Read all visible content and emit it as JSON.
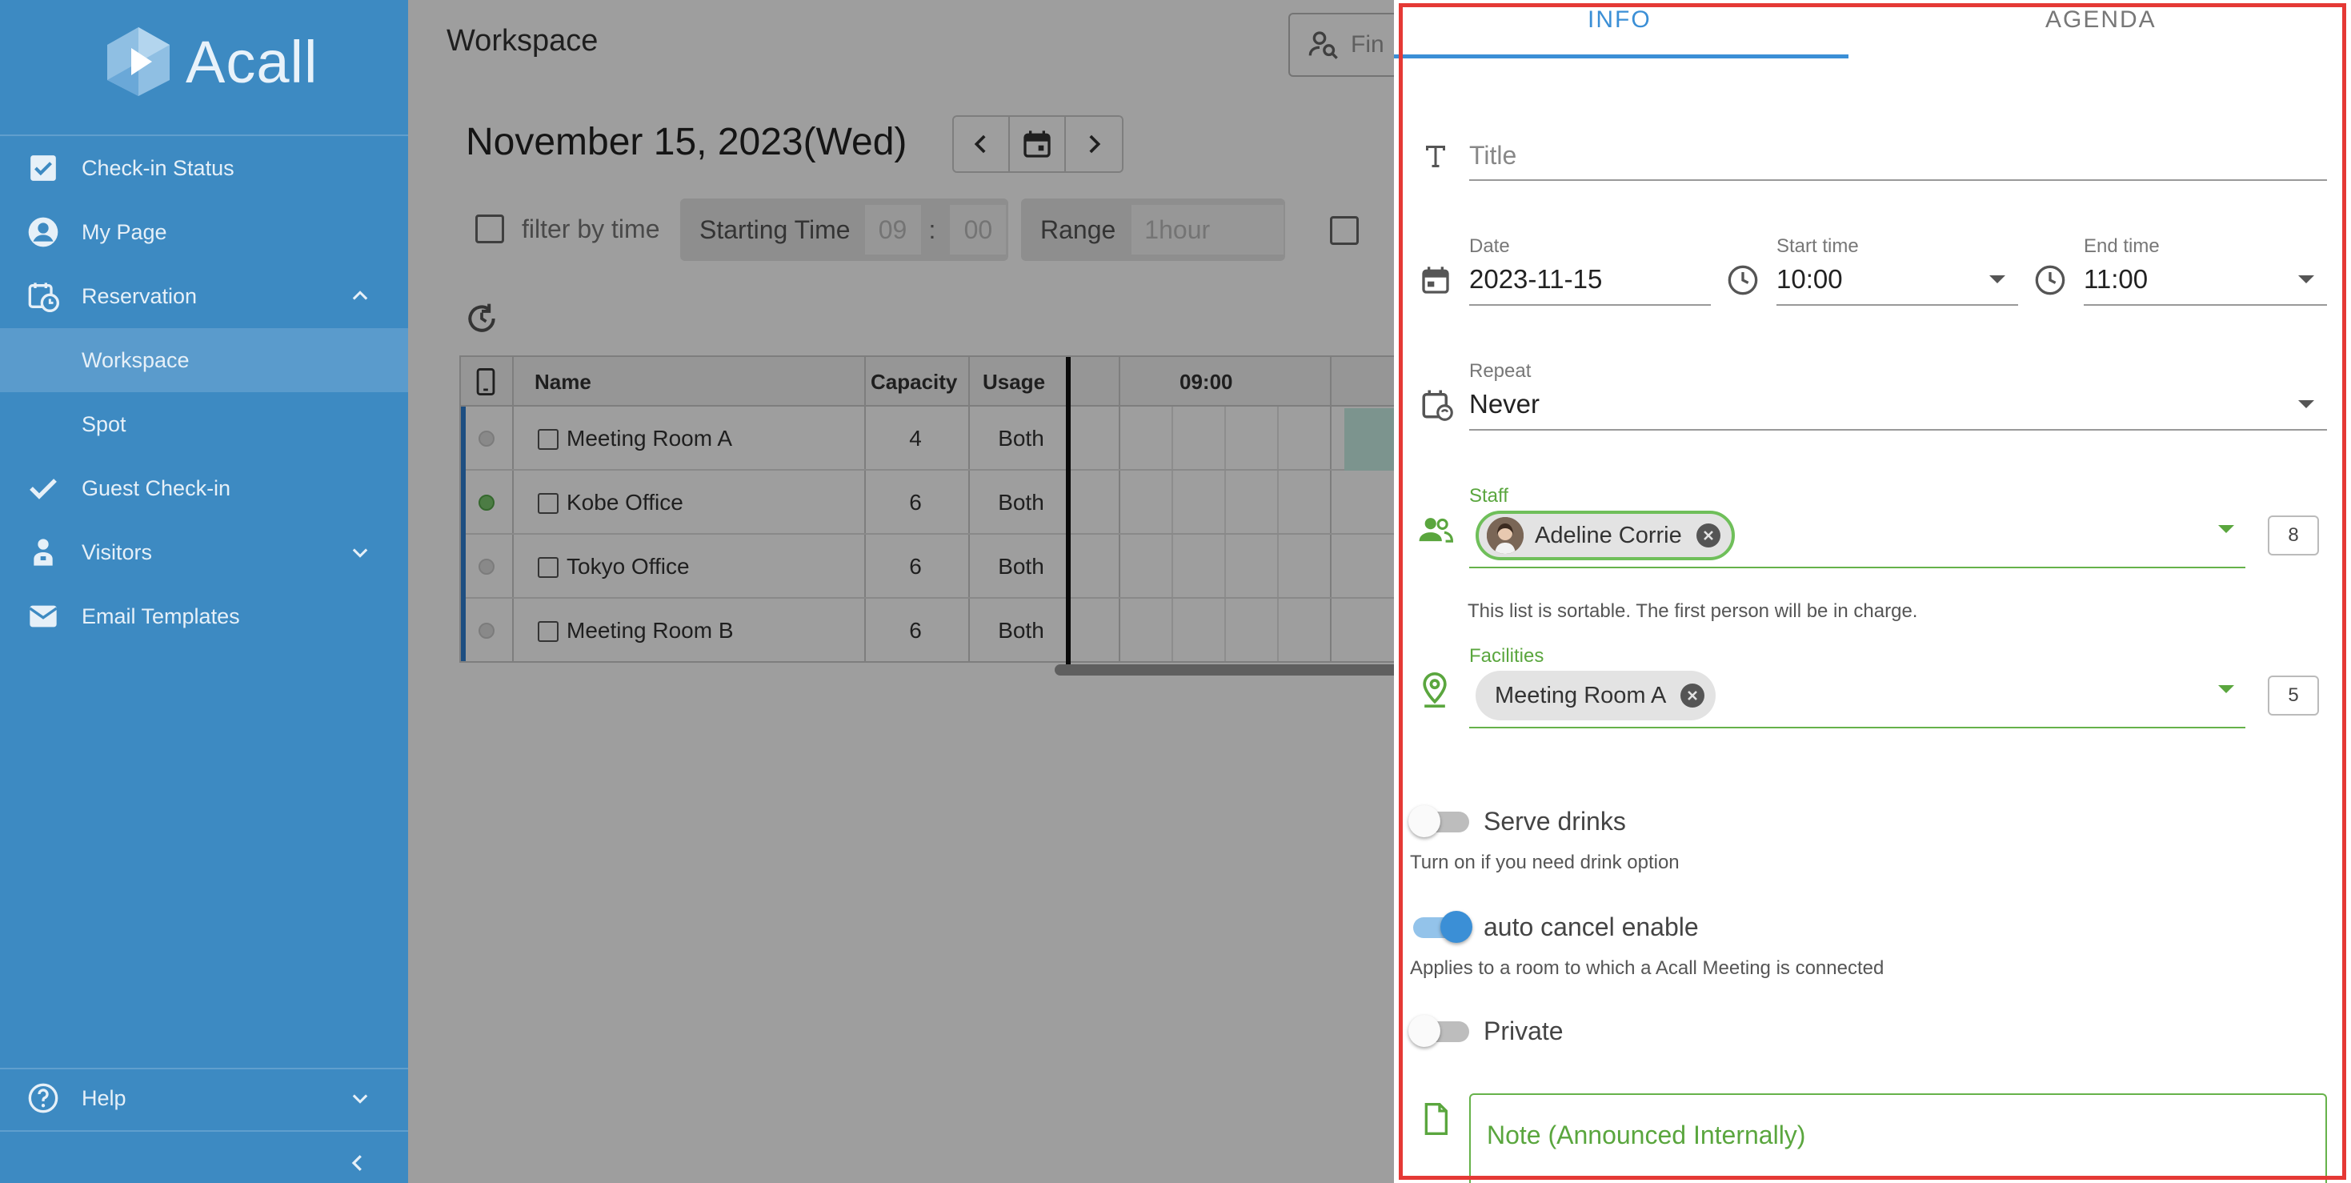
{
  "app": {
    "logo_text": "Acall"
  },
  "sidebar": {
    "items": [
      {
        "label": "Check-in Status",
        "icon": "checkbox-icon"
      },
      {
        "label": "My Page",
        "icon": "account-icon"
      },
      {
        "label": "Reservation",
        "icon": "calendar-clock-icon",
        "expanded": true
      },
      {
        "label": "Workspace",
        "sub": true,
        "active": true
      },
      {
        "label": "Spot",
        "sub": true
      },
      {
        "label": "Guest Check-in",
        "icon": "check-icon"
      },
      {
        "label": "Visitors",
        "icon": "visitor-icon",
        "expanded": false
      },
      {
        "label": "Email Templates",
        "icon": "mail-icon"
      }
    ],
    "help": "Help"
  },
  "workspace": {
    "title": "Workspace",
    "search_placeholder": "Fin",
    "date": "November 15, 2023(Wed)",
    "filter_by_time": "filter by time",
    "starting_time_label": "Starting Time",
    "start_hour": "09",
    "start_min": "00",
    "range_label": "Range",
    "range_value": "1hour",
    "table": {
      "headers": [
        "Name",
        "Capacity",
        "Usage"
      ],
      "time_header": "09:00",
      "rows": [
        {
          "name": "Meeting Room A",
          "capacity": "4",
          "usage": "Both",
          "status": "grey"
        },
        {
          "name": "Kobe Office",
          "capacity": "6",
          "usage": "Both",
          "status": "green"
        },
        {
          "name": "Tokyo Office",
          "capacity": "6",
          "usage": "Both",
          "status": "grey"
        },
        {
          "name": "Meeting Room B",
          "capacity": "6",
          "usage": "Both",
          "status": "grey"
        }
      ]
    }
  },
  "drawer": {
    "tabs": [
      "INFO",
      "AGENDA"
    ],
    "active_tab": "INFO",
    "title_placeholder": "Title",
    "date_label": "Date",
    "date_value": "2023-11-15",
    "start_label": "Start time",
    "start_value": "10:00",
    "end_label": "End time",
    "end_value": "11:00",
    "repeat_label": "Repeat",
    "repeat_value": "Never",
    "staff_label": "Staff",
    "staff_chip": "Adeline Corrie",
    "staff_count": "8",
    "staff_hint": "This list is sortable. The first person will be in charge.",
    "facilities_label": "Facilities",
    "facility_chip": "Meeting Room A",
    "facility_count": "5",
    "serve_drinks_label": "Serve drinks",
    "serve_drinks_hint": "Turn on if you need drink option",
    "serve_drinks_on": false,
    "auto_cancel_label": "auto cancel enable",
    "auto_cancel_hint": "Applies to a room to which a Acall Meeting is connected",
    "auto_cancel_on": true,
    "private_label": "Private",
    "private_on": false,
    "note_placeholder": "Note (Announced Internally)"
  },
  "colors": {
    "sidebar_bg": "#3d8ac2",
    "accent_blue": "#3b8fd6",
    "accent_green": "#5aa63e",
    "frame_red": "#e53935"
  }
}
